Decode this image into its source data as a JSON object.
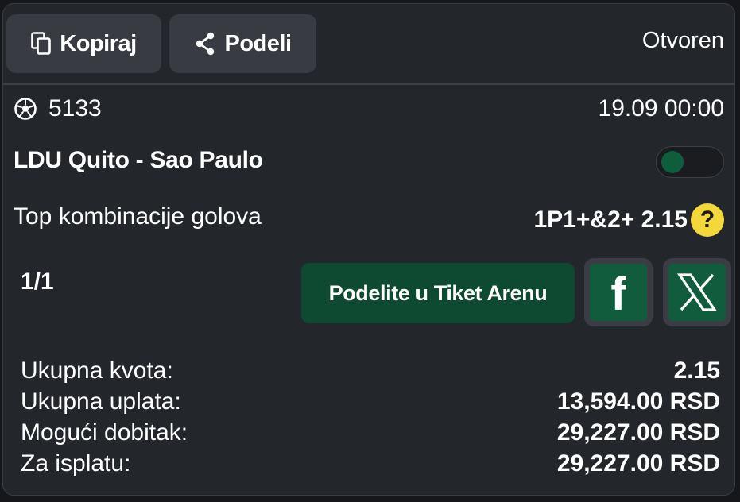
{
  "header": {
    "copy_label": "Kopiraj",
    "share_label": "Podeli",
    "status": "Otvoren"
  },
  "event": {
    "sport_icon": "soccer-ball-icon",
    "id": "5133",
    "datetime": "19.09 00:00",
    "match": "LDU Quito - Sao Paulo",
    "toggle_on": false,
    "market": "Top kombinacije golova",
    "pick": "1P1+&2+ 2.15",
    "help_label": "?"
  },
  "ticket": {
    "counter": "1/1",
    "arena_label": "Podelite u Tiket Arenu",
    "facebook_label": "f"
  },
  "totals": [
    {
      "label": "Ukupna kvota:",
      "value": "2.15"
    },
    {
      "label": "Ukupna uplata:",
      "value": "13,594.00 RSD"
    },
    {
      "label": "Mogući dobitak:",
      "value": "29,227.00 RSD"
    },
    {
      "label": "Za isplatu:",
      "value": "29,227.00 RSD"
    }
  ],
  "colors": {
    "accent_green": "#115c3c",
    "help_yellow": "#f2d83a",
    "card_bg": "#23262b"
  }
}
